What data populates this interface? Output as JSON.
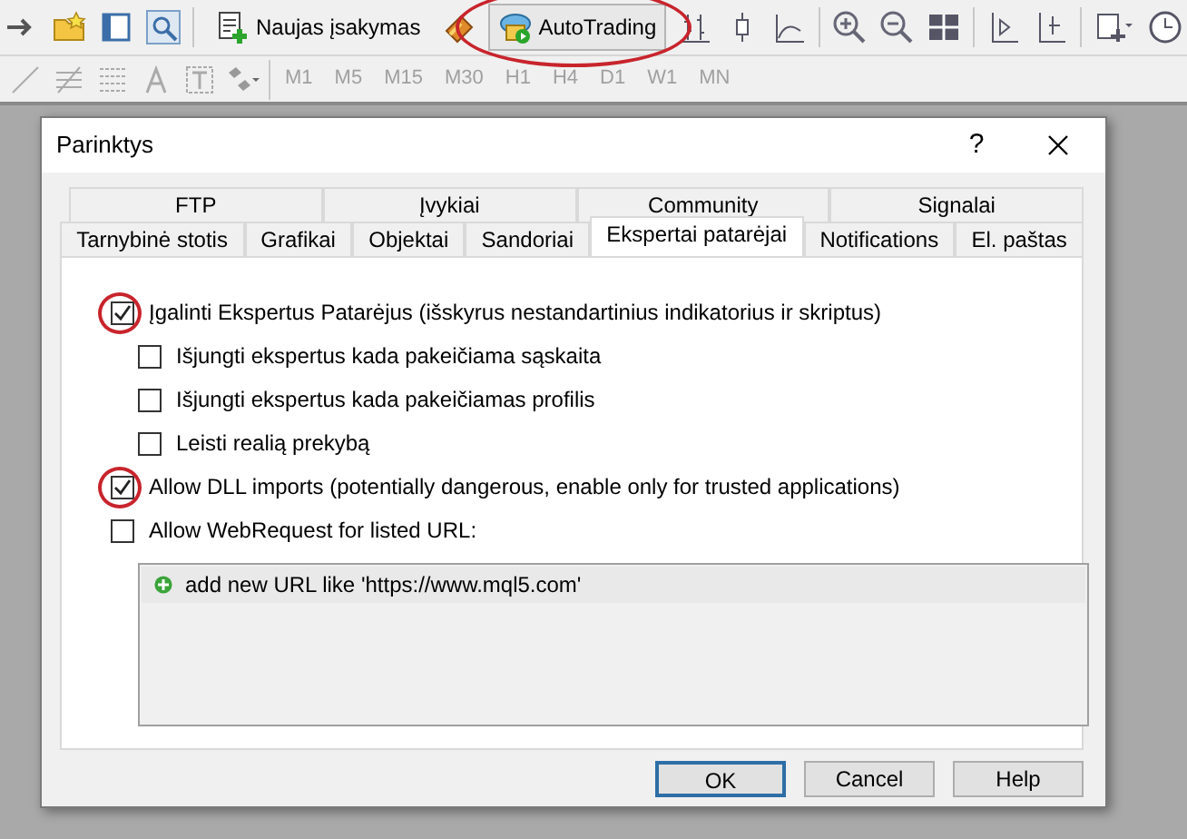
{
  "toolbar": {
    "new_order": {
      "label": "Naujas įsakymas"
    },
    "autotrading": {
      "label": "AutoTrading",
      "circled": true
    },
    "timeframes": [
      {
        "label": "M1",
        "disabled": true
      },
      {
        "label": "M5",
        "disabled": true
      },
      {
        "label": "M15",
        "disabled": true
      },
      {
        "label": "M30",
        "disabled": true
      },
      {
        "label": "H1",
        "disabled": true
      },
      {
        "label": "H4",
        "disabled": true
      },
      {
        "label": "D1",
        "disabled": true
      },
      {
        "label": "W1",
        "disabled": true
      },
      {
        "label": "MN",
        "disabled": true
      }
    ]
  },
  "dialog": {
    "title": "Parinktys",
    "help": "?",
    "tab_rows": [
      [
        {
          "label": "FTP",
          "selected": false
        },
        {
          "label": "Įvykiai",
          "selected": false
        },
        {
          "label": "Community",
          "selected": false
        },
        {
          "label": "Signalai",
          "selected": false
        }
      ],
      [
        {
          "label": "Tarnybinė stotis",
          "selected": false
        },
        {
          "label": "Grafikai",
          "selected": false
        },
        {
          "label": "Objektai",
          "selected": false
        },
        {
          "label": "Sandoriai",
          "selected": false
        },
        {
          "label": "Ekspertai patarėjai",
          "selected": true
        },
        {
          "label": "Notifications",
          "selected": false
        },
        {
          "label": "El. paštas",
          "selected": false
        }
      ]
    ],
    "options": [
      {
        "label": "Įgalinti Ekspertus Patarėjus (išskyrus nestandartinius indikatorius ir skriptus)",
        "checked": true,
        "circled": true,
        "children": [
          {
            "label": "Išjungti ekspertus kada pakeičiama sąskaita",
            "checked": false,
            "circled": false
          },
          {
            "label": "Išjungti ekspertus kada pakeičiamas profilis",
            "checked": false,
            "circled": false
          },
          {
            "label": "Leisti realią prekybą",
            "checked": false,
            "circled": false
          }
        ]
      },
      {
        "label": "Allow DLL imports (potentially dangerous, enable only for trusted applications)",
        "checked": true,
        "circled": true
      },
      {
        "label": "Allow WebRequest for listed URL:",
        "checked": false,
        "circled": false
      }
    ],
    "url_list": [
      "add new URL like 'https://www.mql5.com'"
    ],
    "buttons": [
      {
        "label": "OK",
        "default": true
      },
      {
        "label": "Cancel",
        "default": false
      },
      {
        "label": "Help",
        "default": false
      }
    ]
  }
}
